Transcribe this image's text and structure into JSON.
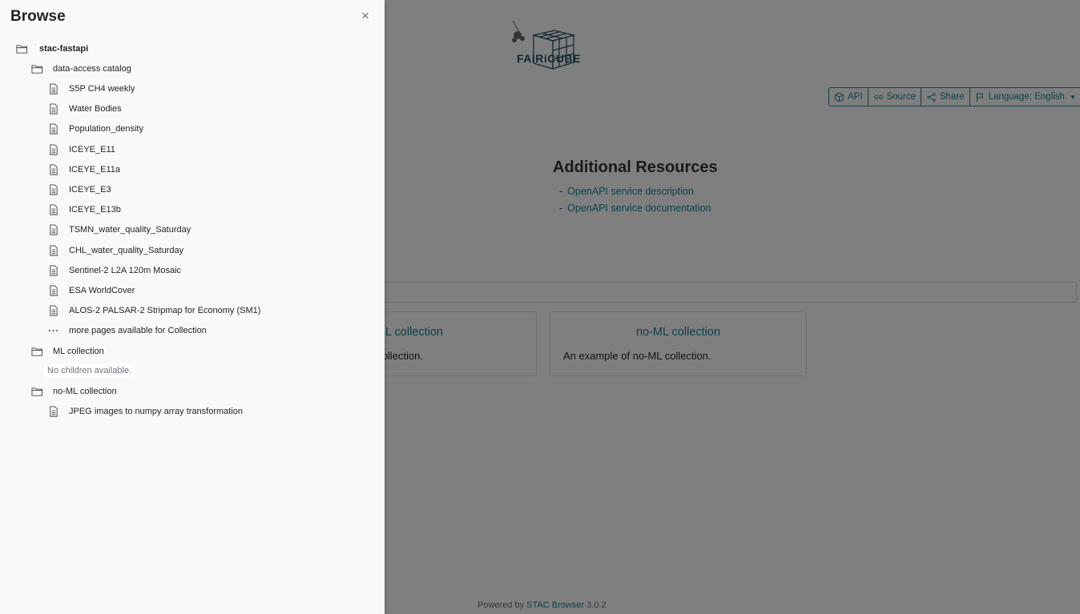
{
  "page": {
    "logo_text": "FAIRiCUBE",
    "toolbar": {
      "api": "API",
      "source": "Source",
      "share": "Share",
      "language": "Language: English"
    },
    "additional_resources": {
      "title": "Additional Resources",
      "links": [
        "OpenAPI service description",
        "OpenAPI service documentation"
      ]
    },
    "cards": [
      {
        "title": "L collection",
        "description": "ollection."
      },
      {
        "title": "no-ML collection",
        "description": "An example of no-ML collection."
      }
    ],
    "footer": {
      "prefix": "Powered by",
      "link": "STAC Browser",
      "version": "3.0.2"
    }
  },
  "sidebar": {
    "title": "Browse",
    "close_symbol": "×",
    "root": "stac-fastapi",
    "catalog": "data-access catalog",
    "catalog_items": [
      "S5P CH4 weekly",
      "Water Bodies",
      "Population_density",
      "ICEYE_E11",
      "ICEYE_E11a",
      "ICEYE_E3",
      "ICEYE_E13b",
      "TSMN_water_quality_Saturday",
      "CHL_water_quality_Saturday",
      "Sentinel-2 L2A 120m Mosaic",
      "ESA WorldCover",
      "ALOS-2 PALSAR-2 Stripmap for Economy (SM1)"
    ],
    "more_pages": "more pages available for Collection",
    "ml_collection": "ML collection",
    "no_children": "No children available.",
    "noml_collection": "no-ML collection",
    "noml_items": [
      "JPEG images to numpy array transformation"
    ]
  }
}
